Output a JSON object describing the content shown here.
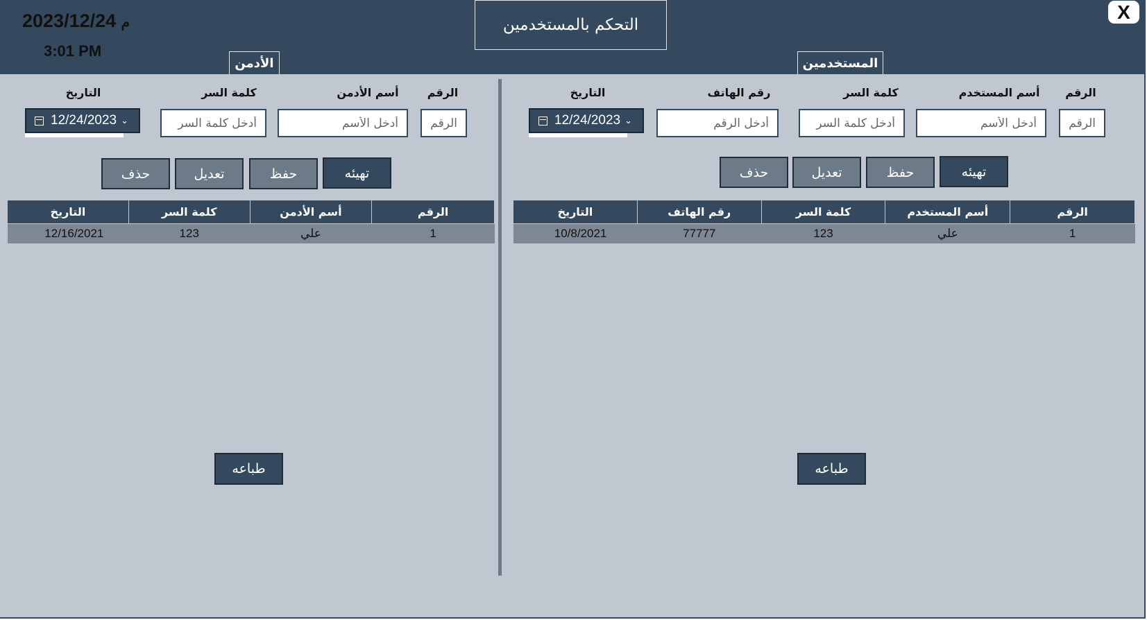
{
  "header": {
    "date": "2023/12/24",
    "era_suffix": "م",
    "time": "3:01 PM",
    "title": "التحكم بالمستخدمين",
    "close_label": "X"
  },
  "tabs": {
    "admin": "الأدمن",
    "users": "المستخدمين"
  },
  "admin_panel": {
    "labels": {
      "id": "الرقم",
      "name": "أسم الأدمن",
      "password": "كلمة السر",
      "date": "التاريخ"
    },
    "placeholders": {
      "id": "الرقم",
      "name": "أدخل الأسم",
      "password": "أدخل كلمة السر"
    },
    "date_value": "12/24/2023",
    "buttons": {
      "reset": "تهيئه",
      "save": "حفظ",
      "edit": "تعديل",
      "delete": "حذف",
      "print": "طباعه"
    },
    "table": {
      "headers": [
        "التاريخ",
        "كلمة السر",
        "أسم الأدمن",
        "الرقم"
      ],
      "rows": [
        [
          "12/16/2021",
          "123",
          "علي",
          "1"
        ]
      ]
    }
  },
  "users_panel": {
    "labels": {
      "id": "الرقم",
      "name": "أسم المستخدم",
      "password": "كلمة السر",
      "phone": "رقم الهاتف",
      "date": "التاريخ"
    },
    "placeholders": {
      "id": "الرقم",
      "name": "أدخل الأسم",
      "password": "أدخل كلمة السر",
      "phone": "أدخل الرقم"
    },
    "date_value": "12/24/2023",
    "buttons": {
      "reset": "تهيئه",
      "save": "حفظ",
      "edit": "تعديل",
      "delete": "حذف",
      "print": "طباعه"
    },
    "table": {
      "headers": [
        "التاريخ",
        "رقم الهاتف",
        "كلمة السر",
        "أسم المستخدم",
        "الرقم"
      ],
      "rows": [
        [
          "10/8/2021",
          "77777",
          "123",
          "علي",
          "1"
        ]
      ]
    }
  },
  "colors": {
    "header_bg": "#34495e",
    "body_bg": "#c1c7d0",
    "row_bg": "#7d8894",
    "button_gray": "#6d7b88"
  }
}
